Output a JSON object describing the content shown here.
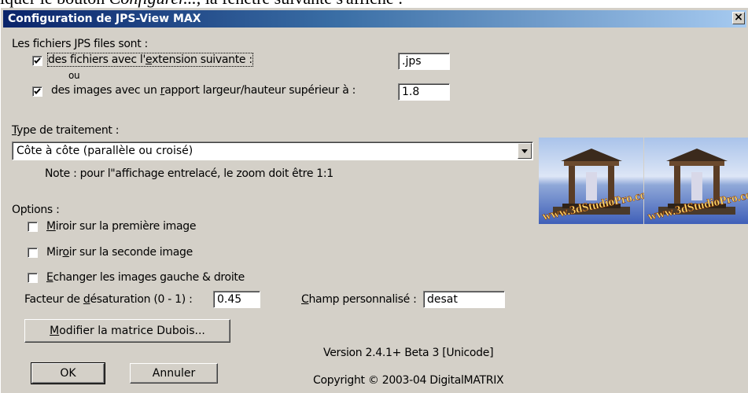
{
  "doc_line": {
    "prefix": "iquer le bouton ",
    "italic": "Configurer...",
    "suffix": ", la fenêtre suivante s'affiche :"
  },
  "dialog": {
    "title": "Configuration de JPS-View MAX",
    "close": "×"
  },
  "files_section": {
    "heading": "Les fichiers JPS files sont :",
    "ext_option": {
      "checked": true,
      "pre": "des fichiers avec l'",
      "ul": "e",
      "post": "xtension suivante :",
      "value": ".jps"
    },
    "or_text": "ou",
    "ratio_option": {
      "checked": true,
      "pre": "des images avec un ",
      "ul": "r",
      "post": "apport largeur/hauteur supérieur à :",
      "value": "1.8"
    }
  },
  "processing": {
    "label_ul": "T",
    "label_rest": "ype de traitement :",
    "selected": "Côte à côte (parallèle ou croisé)",
    "note": "Note : pour l\"affichage entrelacé, le zoom doit être 1:1"
  },
  "preview": {
    "caption_left": "www.3dStudioPro.com",
    "caption_right": "www.3dStudioPro.com"
  },
  "options": {
    "heading": "Options :",
    "mirror_first": {
      "checked": false,
      "ul": "M",
      "rest": "iroir sur la première image"
    },
    "mirror_second": {
      "checked": false,
      "pre": "Mir",
      "ul": "o",
      "rest": "ir sur la seconde image"
    },
    "swap": {
      "checked": false,
      "ul": "E",
      "rest": "changer les images gauche & droite"
    },
    "desat": {
      "pre": "Facteur de ",
      "ul": "d",
      "rest": "ésaturation (0 - 1) :",
      "value": "0.45"
    },
    "custom": {
      "ul": "C",
      "rest": "hamp personnalisé :",
      "value": "desat"
    }
  },
  "buttons": {
    "dubois": {
      "ul": "M",
      "rest": "odifier la matrice Dubois..."
    },
    "ok": "OK",
    "cancel": "Annuler"
  },
  "footer": {
    "version": "Version 2.4.1+ Beta  3 [Unicode]",
    "copyright": "Copyright © 2003-04 DigitalMATRIX"
  }
}
